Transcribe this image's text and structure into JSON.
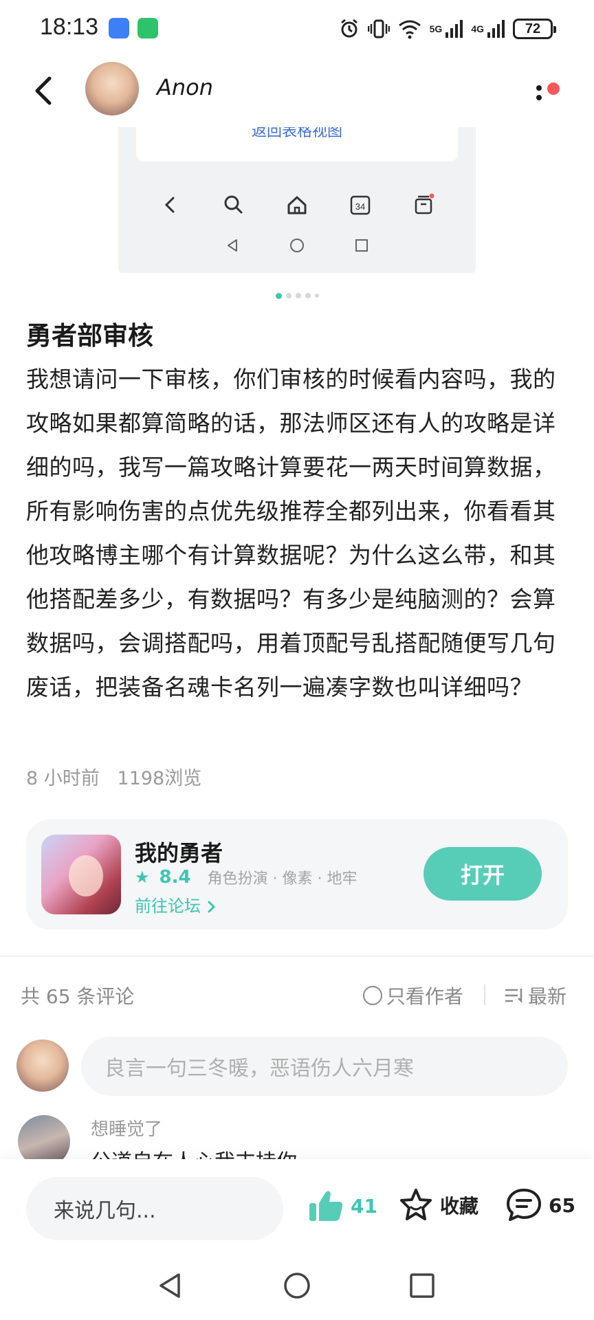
{
  "status_bar": {
    "time": "18:13",
    "network_5g": "5G",
    "network_4g": "4G",
    "battery": "72"
  },
  "header": {
    "username": "Anon"
  },
  "embed": {
    "link_text": "返回表格视图",
    "calendar_day": "34"
  },
  "article": {
    "title": "勇者部审核",
    "body": "我想请问一下审核，你们审核的时候看内容吗，我的攻略如果都算简略的话，那法师区还有人的攻略是详细的吗，我写一篇攻略计算要花一两天时间算数据，所有影响伤害的点优先级推荐全都列出来，你看看其他攻略博主哪个有计算数据呢？为什么这么带，和其他搭配差多少，有数据吗？有多少是纯脑测的？会算数据吗，会调搭配吗，用着顶配号乱搭配随便写几句废话，把装备名魂卡名列一遍凑字数也叫详细吗？",
    "time": "8 小时前",
    "views": "1198浏览"
  },
  "game_card": {
    "name": "我的勇者",
    "rating": "8.4",
    "tags": "角色扮演 · 像素 · 地牢",
    "forum_link": "前往论坛",
    "open_button": "打开"
  },
  "comments": {
    "count_label": "共 65 条评论",
    "only_author": "只看作者",
    "sort": "最新",
    "input_placeholder": "良言一句三冬暖，恶语伤人六月寒",
    "first_reply": {
      "name": "想睡觉了",
      "text": "公道自在人心我支持你"
    }
  },
  "bottom_bar": {
    "say_placeholder": "来说几句...",
    "likes": "41",
    "favorite": "收藏",
    "comment_count": "65"
  },
  "colors": {
    "accent": "#3cc6b2",
    "open_button": "#57cdb8",
    "notify_dot": "#f25a5a"
  }
}
